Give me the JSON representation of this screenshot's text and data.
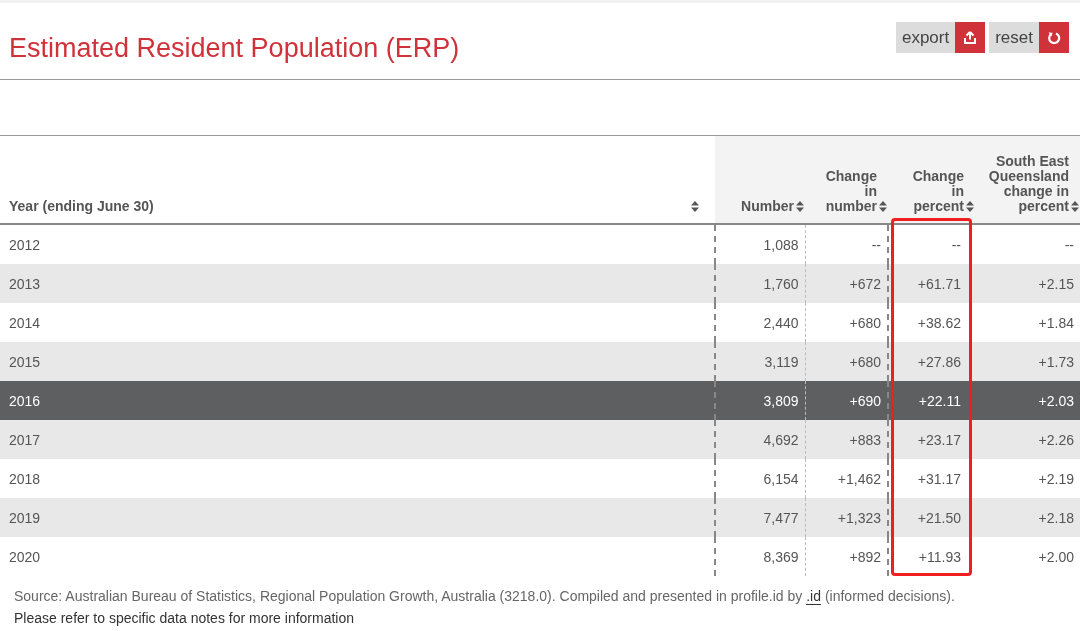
{
  "title": "Estimated Resident Population (ERP)",
  "buttons": [
    {
      "label": "export",
      "kind": "export"
    },
    {
      "label": "reset",
      "kind": "reset"
    }
  ],
  "table": {
    "columns": [
      {
        "label": "Year (ending June 30)"
      },
      {
        "label": "Number"
      },
      {
        "label": "Change in number"
      },
      {
        "label": "Change in percent",
        "highlighted": true
      },
      {
        "label": "South East Queensland change in percent"
      }
    ],
    "rows": [
      {
        "cells": [
          "2012",
          "1,088",
          "--",
          "--",
          "--"
        ],
        "selected": false
      },
      {
        "cells": [
          "2013",
          "1,760",
          "+672",
          "+61.71",
          "+2.15"
        ],
        "selected": false
      },
      {
        "cells": [
          "2014",
          "2,440",
          "+680",
          "+38.62",
          "+1.84"
        ],
        "selected": false
      },
      {
        "cells": [
          "2015",
          "3,119",
          "+680",
          "+27.86",
          "+1.73"
        ],
        "selected": false
      },
      {
        "cells": [
          "2016",
          "3,809",
          "+690",
          "+22.11",
          "+2.03"
        ],
        "selected": true
      },
      {
        "cells": [
          "2017",
          "4,692",
          "+883",
          "+23.17",
          "+2.26"
        ],
        "selected": false
      },
      {
        "cells": [
          "2018",
          "6,154",
          "+1,462",
          "+31.17",
          "+2.19"
        ],
        "selected": false
      },
      {
        "cells": [
          "2019",
          "7,477",
          "+1,323",
          "+21.50",
          "+2.18"
        ],
        "selected": false
      },
      {
        "cells": [
          "2020",
          "8,369",
          "+892",
          "+11.93",
          "+2.00"
        ],
        "selected": false
      }
    ]
  },
  "source": {
    "text": "Source: Australian Bureau of Statistics, Regional Population Growth, Australia (3218.0). Compiled and presented in profile.id by",
    "link": ".id",
    "after": "(informed decisions)."
  },
  "note": "Please refer to specific data notes for more information"
}
